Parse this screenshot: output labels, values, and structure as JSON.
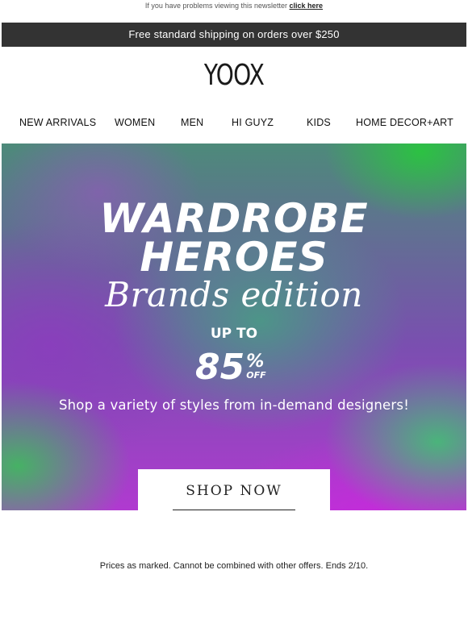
{
  "preheader": {
    "text": "If you have problems viewing this newsletter",
    "link": "click here"
  },
  "shipping_bar": {
    "text": "Free standard shipping on orders over $250"
  },
  "brand": {
    "logo": "YOOX"
  },
  "nav": {
    "items": [
      {
        "label": "NEW ARRIVALS"
      },
      {
        "label": "WOMEN"
      },
      {
        "label": "MEN"
      },
      {
        "label": "HI GUYZ"
      },
      {
        "label": "KIDS"
      },
      {
        "label": "HOME DECOR+ART"
      }
    ]
  },
  "hero": {
    "title_line1": "WARDROBE",
    "title_line2": "HEROES",
    "script": "Brands edition",
    "up_to": "UP TO",
    "discount_number": "85",
    "discount_symbol": "%",
    "discount_off": "OFF",
    "subtitle": "Shop a variety of styles from in-demand designers!",
    "cta_label": "SHOP NOW",
    "colors": {
      "purple": "#b03ad0",
      "green": "#3ab86a"
    }
  },
  "terms": {
    "text": "Prices as marked. Cannot be combined with other offers. Ends 2/10."
  },
  "colors": {
    "shipping_bar_bg": "#333333",
    "text": "#111111",
    "background": "#ffffff"
  }
}
